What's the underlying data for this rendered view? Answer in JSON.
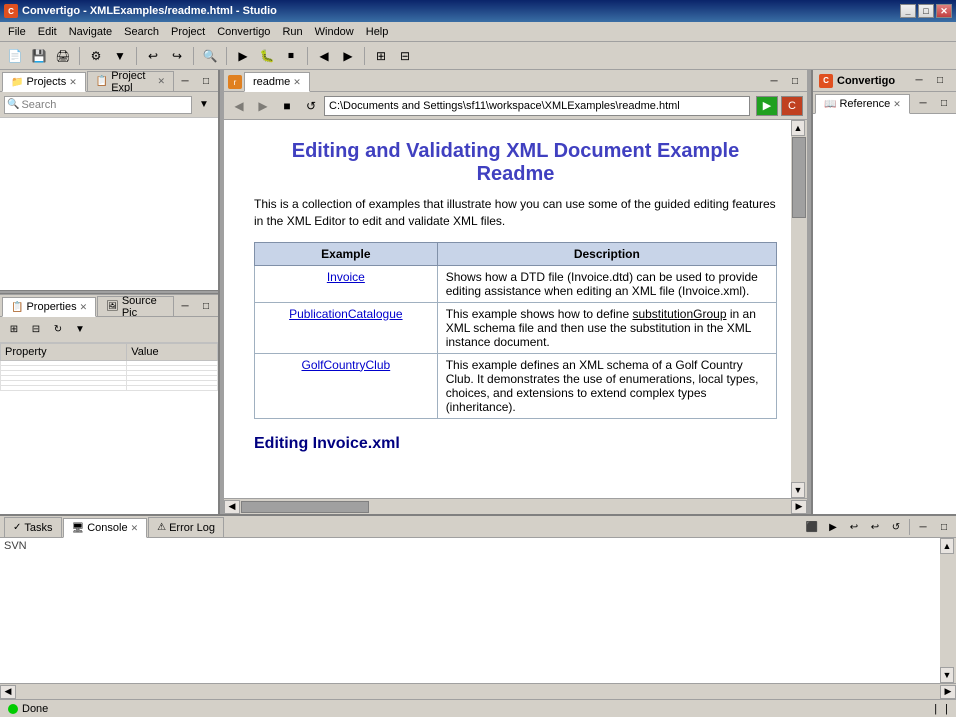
{
  "titleBar": {
    "text": "Convertigo - XMLExamples/readme.html - Studio",
    "buttons": [
      "minimize",
      "maximize",
      "close"
    ]
  },
  "menuBar": {
    "items": [
      "File",
      "Edit",
      "Navigate",
      "Search",
      "Project",
      "Convertigo",
      "Run",
      "Window",
      "Help"
    ]
  },
  "leftPanel": {
    "tabs": [
      {
        "id": "projects",
        "label": "Projects",
        "active": true,
        "closable": true
      },
      {
        "id": "project-expl",
        "label": "Project Expl",
        "active": false,
        "closable": true
      }
    ],
    "searchPlaceholder": "Search"
  },
  "propertiesPanel": {
    "tabs": [
      {
        "id": "properties",
        "label": "Properties",
        "active": true,
        "closable": true
      },
      {
        "id": "source-pic",
        "label": "Source Pic",
        "active": false,
        "closable": false
      }
    ],
    "columns": [
      "Property",
      "Value"
    ],
    "rows": []
  },
  "editorTabs": [
    {
      "id": "readme",
      "label": "readme",
      "active": true,
      "closable": true
    }
  ],
  "browserToolbar": {
    "backBtn": "◀",
    "forwardBtn": "▶",
    "stopBtn": "■",
    "refreshBtn": "↺",
    "addressUrl": "C:\\Documents and Settings\\sf11\\workspace\\XMLExamples\\readme.html",
    "goBtn": "▶",
    "convertBtn": "C"
  },
  "editorContent": {
    "title": "Editing and Validating XML Document Example Readme",
    "intro": "This is a collection of examples that illustrate how you can use some of the guided editing features in the XML Editor to edit and validate XML files.",
    "tableHeaders": [
      "Example",
      "Description"
    ],
    "tableRows": [
      {
        "link": "Invoice",
        "description": "Shows how a DTD file (Invoice.dtd) can be used to provide editing assistance when editing an XML file (Invoice.xml)."
      },
      {
        "link": "PublicationCatalogue",
        "description": "This example shows how to define substitutionGroup in an XML schema file and then use the substitution in the XML instance document."
      },
      {
        "link": "GolfCountryClub",
        "description": "This example defines an XML schema of a Golf Country Club. It demonstrates the use of enumerations, local types, choices, and extensions to extend complex types (inheritance)."
      }
    ],
    "section2Title": "Editing Invoice.xml"
  },
  "rightPanel": {
    "tabs": [
      {
        "id": "reference",
        "label": "Reference",
        "active": true,
        "closable": true
      }
    ]
  },
  "bottomPanel": {
    "tabs": [
      {
        "id": "tasks",
        "label": "Tasks",
        "active": false,
        "closable": false
      },
      {
        "id": "console",
        "label": "Console",
        "active": true,
        "closable": true
      },
      {
        "id": "error-log",
        "label": "Error Log",
        "active": false,
        "closable": false
      }
    ],
    "content": "SVN"
  },
  "statusBar": {
    "text": "Done"
  },
  "convertigoPanel": {
    "label": "Convertigo"
  }
}
